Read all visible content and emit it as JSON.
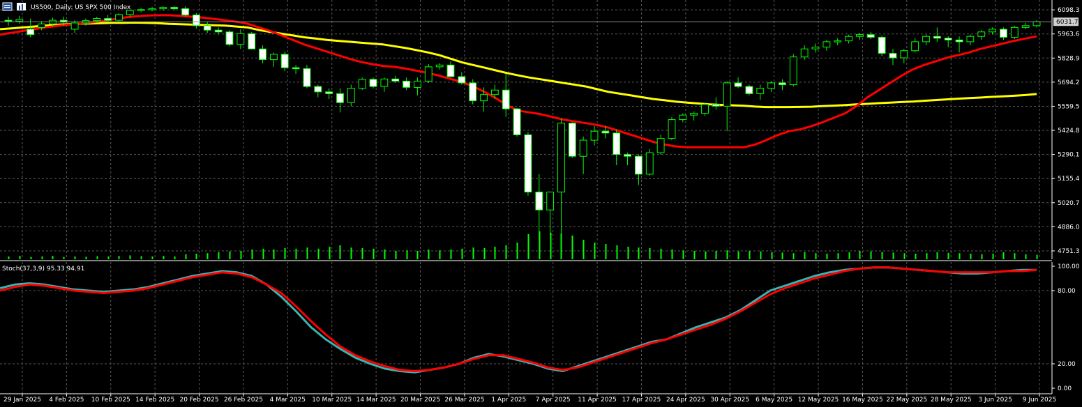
{
  "header": {
    "symbol_label": "US500, Daily:  US SPX 500 Index"
  },
  "stoch_header": {
    "label": "Stoch(37,3,9) 95.33 94.91"
  },
  "colors": {
    "background": "#000000",
    "grid": "#5a5a5a",
    "axis_text": "#ffffff",
    "candle_up_body": "#000000",
    "candle_down_body": "#ffffff",
    "candle_outline": "#00ff00",
    "volume": "#00ff00",
    "ma_fast": "#ff0000",
    "ma_slow": "#ffff00",
    "stoch_main": "#3cb3b3",
    "stoch_signal": "#ff0000",
    "price_marker_bg": "#d0d0d0",
    "price_marker_text": "#000000"
  },
  "current_price_label": "6031.7",
  "chart_data": [
    {
      "type": "candlestick",
      "title": "US500, Daily:  US SPX 500 Index",
      "y_ticks": [
        "6098.3",
        "5963.6",
        "5828.9",
        "5694.2",
        "5559.5",
        "5424.8",
        "5290.1",
        "5155.4",
        "5020.7",
        "4886.0",
        "4751.3"
      ],
      "ylim": [
        4720,
        6130
      ],
      "x_ticks": [
        "29 Jan 2025",
        "4 Feb 2025",
        "10 Feb 2025",
        "14 Feb 2025",
        "20 Feb 2025",
        "26 Feb 2025",
        "4 Mar 2025",
        "10 Mar 2025",
        "14 Mar 2025",
        "20 Mar 2025",
        "26 Mar 2025",
        "1 Apr 2025",
        "7 Apr 2025",
        "11 Apr 2025",
        "17 Apr 2025",
        "24 Apr 2025",
        "30 Apr 2025",
        "6 May 2025",
        "12 May 2025",
        "16 May 2025",
        "22 May 2025",
        "28 May 2025",
        "3 Jun 2025",
        "9 Jun 2025"
      ],
      "current_price": 6031.7,
      "candles": [
        [
          6040,
          6060,
          6010,
          6035
        ],
        [
          6035,
          6065,
          6020,
          6045
        ],
        [
          5990,
          6050,
          5945,
          5960
        ],
        [
          6000,
          6035,
          5985,
          6020
        ],
        [
          6020,
          6055,
          6005,
          6040
        ],
        [
          6040,
          6060,
          6010,
          6030
        ],
        [
          5990,
          6040,
          5970,
          6025
        ],
        [
          6025,
          6050,
          6010,
          6038
        ],
        [
          6038,
          6060,
          6025,
          6050
        ],
        [
          6050,
          6070,
          6035,
          6040
        ],
        [
          6040,
          6080,
          6030,
          6072
        ],
        [
          6072,
          6100,
          6060,
          6095
        ],
        [
          6095,
          6110,
          6085,
          6100
        ],
        [
          6100,
          6115,
          6090,
          6105
        ],
        [
          6105,
          6118,
          6092,
          6112
        ],
        [
          6112,
          6120,
          6095,
          6105
        ],
        [
          6105,
          6118,
          6060,
          6070
        ],
        [
          6070,
          6080,
          5995,
          6010
        ],
        [
          6010,
          6030,
          5970,
          5985
        ],
        [
          5985,
          6000,
          5960,
          5975
        ],
        [
          5975,
          5985,
          5895,
          5905
        ],
        [
          5905,
          5990,
          5880,
          5965
        ],
        [
          5965,
          5975,
          5880,
          5880
        ],
        [
          5880,
          5900,
          5800,
          5820
        ],
        [
          5820,
          5860,
          5780,
          5850
        ],
        [
          5850,
          5865,
          5755,
          5775
        ],
        [
          5775,
          5790,
          5740,
          5770
        ],
        [
          5770,
          5790,
          5660,
          5670
        ],
        [
          5670,
          5680,
          5610,
          5640
        ],
        [
          5640,
          5660,
          5600,
          5630
        ],
        [
          5630,
          5660,
          5525,
          5580
        ],
        [
          5580,
          5680,
          5560,
          5660
        ],
        [
          5660,
          5720,
          5650,
          5710
        ],
        [
          5710,
          5720,
          5660,
          5670
        ],
        [
          5670,
          5720,
          5640,
          5712
        ],
        [
          5712,
          5730,
          5690,
          5700
        ],
        [
          5700,
          5720,
          5650,
          5665
        ],
        [
          5665,
          5720,
          5620,
          5700
        ],
        [
          5700,
          5795,
          5690,
          5780
        ],
        [
          5780,
          5800,
          5765,
          5790
        ],
        [
          5790,
          5810,
          5720,
          5725
        ],
        [
          5725,
          5750,
          5680,
          5690
        ],
        [
          5690,
          5710,
          5570,
          5590
        ],
        [
          5590,
          5665,
          5530,
          5625
        ],
        [
          5625,
          5680,
          5600,
          5650
        ],
        [
          5650,
          5740,
          5500,
          5545
        ],
        [
          5545,
          5550,
          5390,
          5400
        ],
        [
          5400,
          5415,
          5060,
          5080
        ],
        [
          5080,
          5180,
          4810,
          4980
        ],
        [
          4980,
          5050,
          4840,
          5080
        ],
        [
          5080,
          5490,
          4830,
          5465
        ],
        [
          5465,
          5470,
          5270,
          5280
        ],
        [
          5280,
          5390,
          5180,
          5370
        ],
        [
          5370,
          5450,
          5340,
          5420
        ],
        [
          5420,
          5450,
          5380,
          5410
        ],
        [
          5410,
          5430,
          5230,
          5290
        ],
        [
          5290,
          5300,
          5230,
          5280
        ],
        [
          5280,
          5290,
          5120,
          5180
        ],
        [
          5180,
          5320,
          5170,
          5300
        ],
        [
          5300,
          5400,
          5290,
          5380
        ],
        [
          5380,
          5500,
          5370,
          5485
        ],
        [
          5485,
          5520,
          5470,
          5510
        ],
        [
          5510,
          5530,
          5480,
          5520
        ],
        [
          5520,
          5580,
          5505,
          5570
        ],
        [
          5570,
          5610,
          5540,
          5560
        ],
        [
          5560,
          5700,
          5420,
          5690
        ],
        [
          5690,
          5720,
          5660,
          5670
        ],
        [
          5670,
          5680,
          5620,
          5630
        ],
        [
          5630,
          5680,
          5595,
          5660
        ],
        [
          5660,
          5700,
          5640,
          5690
        ],
        [
          5690,
          5710,
          5650,
          5680
        ],
        [
          5680,
          5850,
          5670,
          5835
        ],
        [
          5835,
          5900,
          5820,
          5880
        ],
        [
          5880,
          5910,
          5860,
          5890
        ],
        [
          5890,
          5930,
          5870,
          5920
        ],
        [
          5920,
          5940,
          5900,
          5925
        ],
        [
          5925,
          5960,
          5910,
          5950
        ],
        [
          5950,
          5970,
          5930,
          5960
        ],
        [
          5960,
          5975,
          5935,
          5945
        ],
        [
          5945,
          5955,
          5840,
          5855
        ],
        [
          5855,
          5880,
          5790,
          5830
        ],
        [
          5830,
          5880,
          5800,
          5870
        ],
        [
          5870,
          5940,
          5860,
          5920
        ],
        [
          5920,
          5960,
          5900,
          5950
        ],
        [
          5950,
          6000,
          5920,
          5940
        ],
        [
          5940,
          5950,
          5890,
          5930
        ],
        [
          5930,
          5950,
          5860,
          5920
        ],
        [
          5920,
          5960,
          5900,
          5950
        ],
        [
          5950,
          5985,
          5930,
          5975
        ],
        [
          5975,
          6000,
          5960,
          5990
        ],
        [
          5990,
          6000,
          5930,
          5945
        ],
        [
          5945,
          6010,
          5935,
          6000
        ],
        [
          6000,
          6025,
          5990,
          6010
        ],
        [
          6010,
          6040,
          6000,
          6031.7
        ]
      ],
      "volume": [
        0.1,
        0.12,
        0.08,
        0.1,
        0.12,
        0.08,
        0.1,
        0.09,
        0.11,
        0.1,
        0.12,
        0.14,
        0.11,
        0.1,
        0.12,
        0.1,
        0.18,
        0.2,
        0.22,
        0.25,
        0.28,
        0.3,
        0.35,
        0.38,
        0.35,
        0.4,
        0.38,
        0.42,
        0.38,
        0.45,
        0.5,
        0.42,
        0.4,
        0.38,
        0.35,
        0.3,
        0.32,
        0.3,
        0.35,
        0.32,
        0.35,
        0.38,
        0.42,
        0.4,
        0.45,
        0.5,
        0.6,
        0.9,
        1.0,
        0.95,
        0.92,
        0.85,
        0.7,
        0.6,
        0.55,
        0.5,
        0.45,
        0.42,
        0.4,
        0.38,
        0.35,
        0.32,
        0.3,
        0.28,
        0.3,
        0.32,
        0.28,
        0.3,
        0.28,
        0.25,
        0.24,
        0.22,
        0.25,
        0.22,
        0.2,
        0.22,
        0.25,
        0.3,
        0.28,
        0.26,
        0.24,
        0.22,
        0.2,
        0.22,
        0.25,
        0.23,
        0.22,
        0.2,
        0.18,
        0.2,
        0.25,
        0.22,
        0.18,
        0.16
      ],
      "ma_fast": [
        5960,
        5970,
        5980,
        5990,
        6000,
        6008,
        6015,
        6020,
        6028,
        6035,
        6045,
        6055,
        6062,
        6066,
        6068,
        6068,
        6065,
        6060,
        6055,
        6048,
        6040,
        6032,
        6020,
        6000,
        5980,
        5955,
        5930,
        5905,
        5885,
        5865,
        5845,
        5825,
        5808,
        5795,
        5785,
        5780,
        5770,
        5758,
        5745,
        5730,
        5712,
        5695,
        5670,
        5640,
        5605,
        5565,
        5535,
        5525,
        5515,
        5500,
        5485,
        5475,
        5465,
        5455,
        5440,
        5420,
        5400,
        5380,
        5360,
        5345,
        5335,
        5330,
        5330,
        5330,
        5330,
        5330,
        5330,
        5345,
        5370,
        5398,
        5420,
        5430,
        5448,
        5470,
        5495,
        5520,
        5560,
        5610,
        5650,
        5690,
        5730,
        5765,
        5790,
        5810,
        5830,
        5845,
        5860,
        5880,
        5895,
        5910,
        5925,
        5938,
        5950
      ],
      "ma_slow": [
        5990,
        5995,
        6000,
        6005,
        6010,
        6015,
        6018,
        6020,
        6022,
        6024,
        6026,
        6026,
        6027,
        6026,
        6024,
        6020,
        6018,
        6016,
        6014,
        6012,
        6010,
        6005,
        6000,
        5985,
        5975,
        5965,
        5955,
        5945,
        5938,
        5930,
        5925,
        5920,
        5915,
        5910,
        5905,
        5895,
        5885,
        5873,
        5860,
        5845,
        5825,
        5805,
        5790,
        5775,
        5760,
        5745,
        5732,
        5720,
        5710,
        5700,
        5690,
        5680,
        5670,
        5655,
        5640,
        5630,
        5620,
        5610,
        5600,
        5593,
        5585,
        5580,
        5575,
        5570,
        5567,
        5565,
        5562,
        5558,
        5555,
        5555,
        5555,
        5556,
        5557,
        5560,
        5563,
        5566,
        5570,
        5573,
        5577,
        5580,
        5583,
        5586,
        5590,
        5594,
        5598,
        5602,
        5605,
        5608,
        5612,
        5615,
        5618,
        5622,
        5628
      ]
    },
    {
      "type": "line",
      "title": "Stoch(37,3,9) 95.33 94.91",
      "y_ticks": [
        "100.00",
        "80.00",
        "20.00",
        "0.00"
      ],
      "ylim": [
        0,
        100
      ],
      "series": [
        {
          "values": [
            82,
            85,
            86,
            85,
            83,
            81,
            80,
            79,
            80,
            81,
            83,
            86,
            89,
            92,
            94,
            96,
            95,
            92,
            85,
            75,
            63,
            50,
            40,
            32,
            25,
            20,
            16,
            14,
            13,
            15,
            17,
            20,
            25,
            28,
            26,
            23,
            20,
            16,
            14,
            18,
            22,
            26,
            30,
            34,
            38,
            40,
            45,
            50,
            54,
            58,
            64,
            72,
            80,
            84,
            88,
            92,
            95,
            97,
            98,
            99,
            99,
            98,
            97,
            96,
            95,
            94,
            94,
            95,
            96,
            97,
            97
          ]
        },
        {
          "values": [
            80,
            83,
            85,
            84,
            82,
            80,
            79,
            78,
            79,
            80,
            82,
            85,
            88,
            91,
            93,
            95,
            94,
            91,
            85,
            78,
            67,
            55,
            44,
            34,
            27,
            22,
            18,
            15,
            14,
            15,
            17,
            20,
            24,
            27,
            27,
            24,
            21,
            17,
            15,
            17,
            21,
            25,
            29,
            33,
            37,
            40,
            44,
            48,
            52,
            57,
            63,
            70,
            77,
            82,
            86,
            90,
            93,
            96,
            98,
            99,
            99,
            98,
            97,
            96,
            95,
            95,
            95,
            95,
            96,
            96,
            97
          ]
        }
      ]
    }
  ]
}
